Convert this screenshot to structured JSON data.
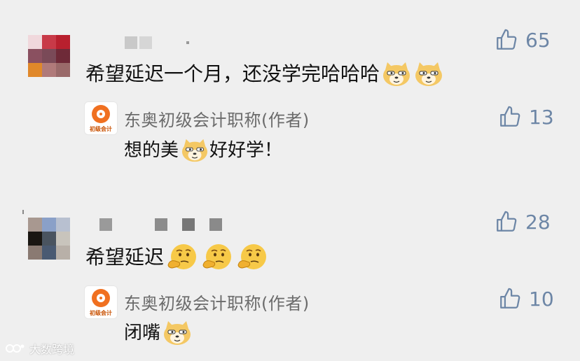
{
  "comments": [
    {
      "text": "希望延迟一个月，还没学完哈哈哈",
      "likes": "65",
      "emoji_count": 2,
      "emoji_icon": "doge-emoji",
      "reply": {
        "author": "东奥初级会计职称(作者)",
        "avatar_label": "初级会计",
        "text_before": "想的美",
        "text_after": "好好学！",
        "emoji_icon": "doge-emoji",
        "likes": "13"
      }
    },
    {
      "text": "希望延迟",
      "likes": "28",
      "emoji_count": 3,
      "emoji_icon": "thinking-face-emoji",
      "reply": {
        "author": "东奥初级会计职称(作者)",
        "avatar_label": "初级会计",
        "text": "闭嘴",
        "emoji_icon": "doge-emoji",
        "likes": "10"
      }
    }
  ],
  "watermark": "大数跨境",
  "colors": {
    "background": "#efefef",
    "like_icon": "#6d86a6",
    "author_name": "#6b6b6b",
    "author_avatar": "#f07020"
  }
}
